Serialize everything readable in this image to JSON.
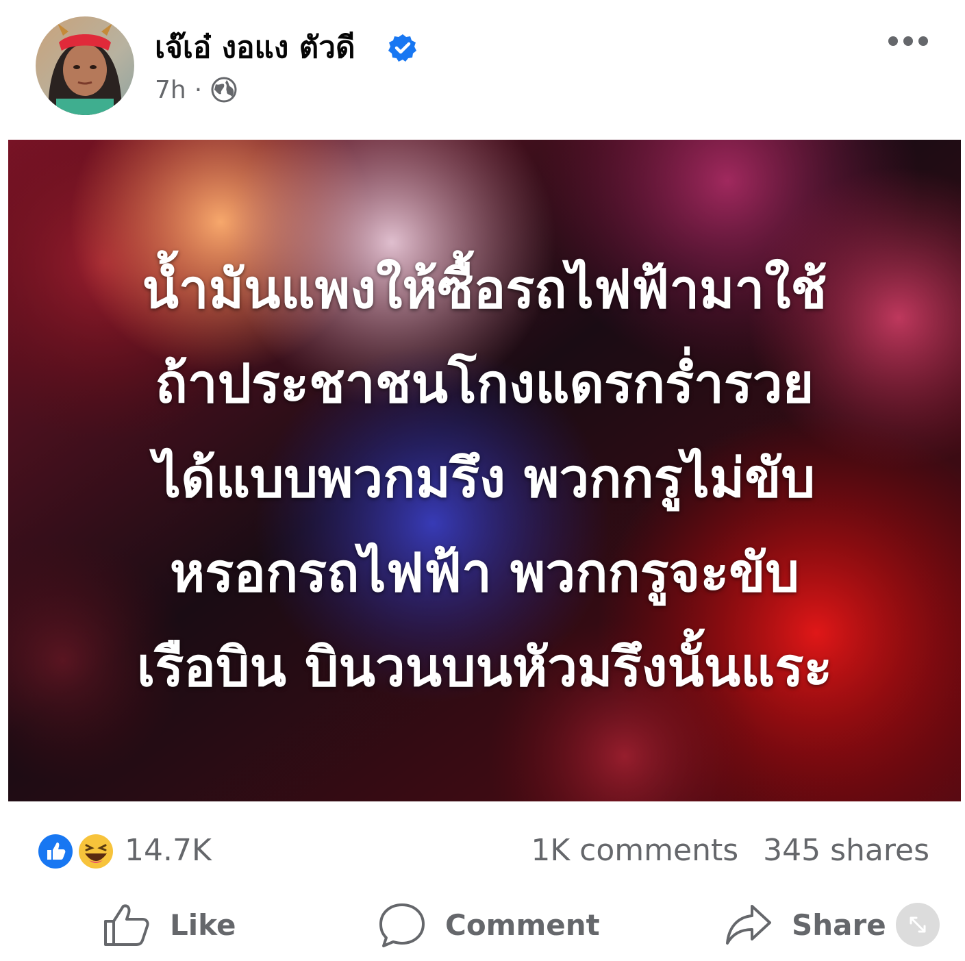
{
  "post": {
    "author_name": "เจ๊เอ๋ งอแง ตัวดี",
    "timestamp": "7h",
    "separator": "·",
    "text_lines": [
      "น้ำมันแพงให้ซื้อรถไฟฟ้ามาใช้",
      "ถ้าประชาชนโกงแดรกร่ำรวย",
      "ได้แบบพวกมรึง พวกกรูไม่ขับ",
      "หรอกรถไฟฟ้า พวกกรูจะขับ",
      "เรือบิน บินวนบนหัวมรึงนั้นแระ"
    ]
  },
  "stats": {
    "reactions_count": "14.7K",
    "comments": "1K comments",
    "shares": "345 shares"
  },
  "actions": {
    "like_label": "Like",
    "comment_label": "Comment",
    "share_label": "Share"
  },
  "icons": {
    "verified": "verified-badge-icon",
    "audience": "globe-icon",
    "more": "more-icon",
    "like": "thumbs-up-icon",
    "comment": "speech-bubble-icon",
    "share": "share-arrow-icon",
    "expand": "expand-icon"
  },
  "colors": {
    "verified_blue": "#1877f2",
    "secondary_text": "#65676b",
    "like_blue": "#1877f2",
    "haha_yellow": "#f7c33b"
  }
}
